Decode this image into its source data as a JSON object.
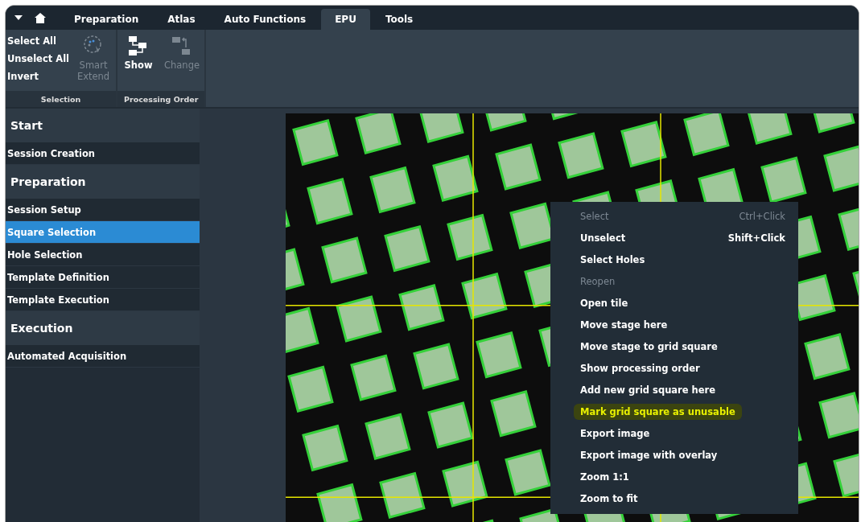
{
  "tabs": [
    {
      "label": "Preparation",
      "selected": false
    },
    {
      "label": "Atlas",
      "selected": false
    },
    {
      "label": "Auto Functions",
      "selected": false
    },
    {
      "label": "EPU",
      "selected": true
    },
    {
      "label": "Tools",
      "selected": false
    }
  ],
  "ribbon": {
    "groups": [
      {
        "label": "Selection",
        "text_buttons": [
          "Select All",
          "Unselect All",
          "Invert"
        ],
        "icon_buttons": [
          {
            "kind": "smart",
            "label": "Smart Extend",
            "disabled": true
          }
        ]
      },
      {
        "label": "Processing Order",
        "icon_buttons": [
          {
            "kind": "show",
            "label": "Show",
            "disabled": false
          },
          {
            "kind": "change",
            "label": "Change",
            "disabled": true
          }
        ]
      }
    ]
  },
  "sidebar": {
    "sections": [
      {
        "title": "Start",
        "items": [
          {
            "label": "Session Creation",
            "selected": false
          }
        ]
      },
      {
        "title": "Preparation",
        "items": [
          {
            "label": "Session Setup",
            "selected": false
          },
          {
            "label": "Square Selection",
            "selected": true
          },
          {
            "label": "Hole Selection",
            "selected": false
          },
          {
            "label": "Template Definition",
            "selected": false
          },
          {
            "label": "Template Execution",
            "selected": false
          }
        ]
      },
      {
        "title": "Execution",
        "items": [
          {
            "label": "Automated Acquisition",
            "selected": false
          }
        ]
      }
    ]
  },
  "context_menu": {
    "items": [
      {
        "label": "Select",
        "shortcut": "Ctrl+Click",
        "disabled": true,
        "highlighted": false
      },
      {
        "label": "Unselect",
        "shortcut": "Shift+Click",
        "disabled": false,
        "highlighted": false
      },
      {
        "label": "Select Holes",
        "disabled": false,
        "highlighted": false
      },
      {
        "label": "Reopen",
        "disabled": true,
        "highlighted": false
      },
      {
        "label": "Open tile",
        "disabled": false,
        "highlighted": false
      },
      {
        "label": "Move stage here",
        "disabled": false,
        "highlighted": false
      },
      {
        "label": "Move stage to grid square",
        "disabled": false,
        "highlighted": false
      },
      {
        "label": "Show processing order",
        "disabled": false,
        "highlighted": false
      },
      {
        "label": "Add new grid square here",
        "disabled": false,
        "highlighted": false
      },
      {
        "label": "Mark grid square as unusable",
        "disabled": false,
        "highlighted": true
      },
      {
        "label": "Export image",
        "disabled": false,
        "highlighted": false
      },
      {
        "label": "Export image with overlay",
        "disabled": false,
        "highlighted": false
      },
      {
        "label": "Zoom 1:1",
        "disabled": false,
        "highlighted": false
      },
      {
        "label": "Zoom to fit",
        "disabled": false,
        "highlighted": false
      }
    ]
  }
}
